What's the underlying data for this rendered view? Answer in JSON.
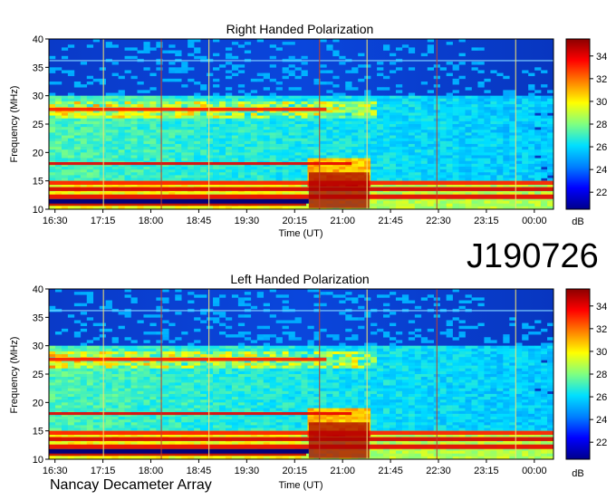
{
  "figure_id": "J190726",
  "credit": "Nancay Decameter Array",
  "colors": {
    "colormap": [
      "#00008b",
      "#0000ff",
      "#0080ff",
      "#00e0ff",
      "#80ff80",
      "#ffff00",
      "#ff8000",
      "#ff0000",
      "#8b0000"
    ]
  },
  "chart_data": [
    {
      "type": "heatmap",
      "title": "Right Handed Polarization",
      "xlabel": "Time (UT)",
      "ylabel": "Frequency (MHz)",
      "x_ticks": [
        "16:30",
        "17:15",
        "18:00",
        "18:45",
        "19:30",
        "20:15",
        "21:00",
        "21:45",
        "22:30",
        "23:15",
        "00:00"
      ],
      "y_ticks": [
        10,
        15,
        20,
        25,
        30,
        35,
        40
      ],
      "ylim": [
        10,
        40
      ],
      "colorbar": {
        "label": "dB",
        "ticks": [
          22,
          24,
          26,
          28,
          30,
          32,
          34
        ],
        "range": [
          20.5,
          35.5
        ]
      }
    },
    {
      "type": "heatmap",
      "title": "Left Handed Polarization",
      "xlabel": "Time (UT)",
      "ylabel": "Frequency (MHz)",
      "x_ticks": [
        "16:30",
        "17:15",
        "18:00",
        "18:45",
        "19:30",
        "20:15",
        "21:00",
        "21:45",
        "22:30",
        "23:15",
        "00:00"
      ],
      "y_ticks": [
        10,
        15,
        20,
        25,
        30,
        35,
        40
      ],
      "ylim": [
        10,
        40
      ],
      "colorbar": {
        "label": "dB",
        "ticks": [
          22,
          24,
          26,
          28,
          30,
          32,
          34
        ],
        "range": [
          20.5,
          35.5
        ]
      }
    }
  ]
}
